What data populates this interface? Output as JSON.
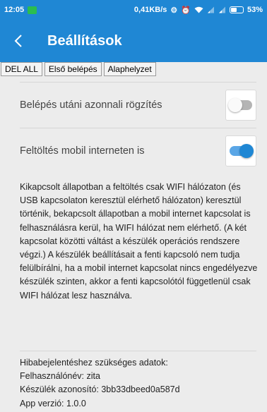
{
  "status_bar": {
    "time": "12:05",
    "network_speed": "0,41KB/s",
    "battery_level": 53,
    "battery_text": "53%",
    "colors": {
      "background": "#1f87d4",
      "gallery_icon": "#2bbd4f"
    }
  },
  "app_bar": {
    "title": "Beállítások",
    "back_icon": "chevron-left-icon"
  },
  "buttons": {
    "del_all": "DEL ALL",
    "first_login": "Első belépés",
    "reset": "Alaphelyzet"
  },
  "settings": [
    {
      "label": "Belépés utáni azonnali rögzítés",
      "enabled": false
    },
    {
      "label": "Feltöltés mobil interneten is",
      "enabled": true
    }
  ],
  "description": "Kikapcsolt állapotban a feltöltés csak WIFI hálózaton (és USB kapcsolaton keresztül elérhető hálózaton) keresztül történik, bekapcsolt állapotban a mobil internet kapcsolat is felhasználásra kerül, ha WIFI hálózat nem elérhető. (A két kapcsolat közötti váltást a készülék operációs rendszere végzi.) A készülék beállításait a fenti kapcsoló nem tudja felülbírálni, ha a mobil internet kapcsolat nincs engedélyezve készülék szinten, akkor a fenti kapcsolótól függetlenül csak WIFI hálózat lesz használva.",
  "debug_info": {
    "heading": "Hibabejelentéshez szükséges adatok:",
    "username": "Felhasználónév: zita",
    "device_id": "Készülék azonosító: 3bb33dbeed0a587d",
    "app_version": "App verzió: 1.0.0"
  },
  "accent_color": "#1f87d4"
}
